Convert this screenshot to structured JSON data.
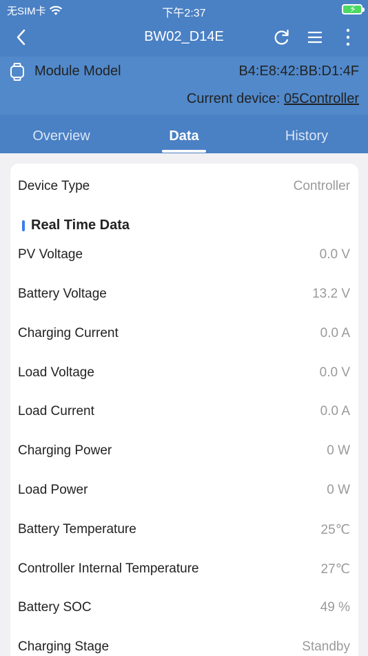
{
  "status_bar": {
    "carrier": "无SIM卡",
    "time": "下午2:37"
  },
  "nav": {
    "title": "BW02_D14E"
  },
  "module": {
    "label": "Module Model",
    "mac": "B4:E8:42:BB:D1:4F",
    "current_prefix": "Current device: ",
    "current_device": "05Controller"
  },
  "tabs": [
    {
      "label": "Overview"
    },
    {
      "label": "Data"
    },
    {
      "label": "History"
    }
  ],
  "device_type": {
    "label": "Device Type",
    "value": "Controller"
  },
  "section_title": "Real Time Data",
  "rows": [
    {
      "label": "PV Voltage",
      "value": "0.0 V"
    },
    {
      "label": "Battery Voltage",
      "value": "13.2 V"
    },
    {
      "label": "Charging Current",
      "value": "0.0 A"
    },
    {
      "label": "Load Voltage",
      "value": "0.0 V"
    },
    {
      "label": "Load Current",
      "value": "0.0 A"
    },
    {
      "label": "Charging Power",
      "value": "0 W"
    },
    {
      "label": "Load Power",
      "value": "0 W"
    },
    {
      "label": "Battery Temperature",
      "value": "25℃"
    },
    {
      "label": "Controller Internal Temperature",
      "value": "27℃"
    },
    {
      "label": "Battery SOC",
      "value": "49 %"
    },
    {
      "label": "Charging Stage",
      "value": "Standby"
    }
  ],
  "colors": {
    "header": "#4a80c4",
    "model_bar": "#5189cb",
    "accent": "#3a7cf0",
    "battery": "#4cd964"
  }
}
